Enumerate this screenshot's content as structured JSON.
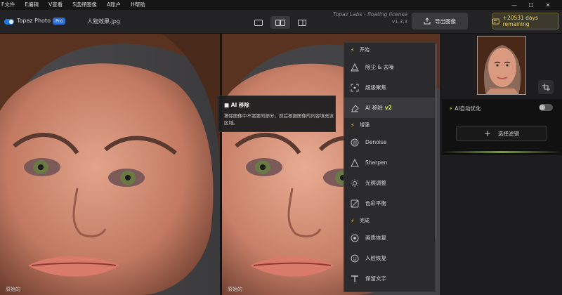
{
  "menubar": {
    "items": [
      "F文件",
      "E编辑",
      "V查看",
      "S选择图像",
      "A账户",
      "H帮助"
    ]
  },
  "window": {
    "minimize": "—",
    "maximize": "☐",
    "close": "✕"
  },
  "toolbar": {
    "app_name": "Topaz Photo",
    "pro_badge": "Pro",
    "file_name": "人物效果.jpg",
    "license_line1": "Topaz Labs - floating license",
    "license_line2": "v1.3.3",
    "export_label": "导出图像",
    "days_remaining": "+20531 days remaining"
  },
  "photos": {
    "left_caption": "原始的",
    "right_caption": "原始的"
  },
  "tooltip": {
    "title": "AI 移除",
    "body": "擦除图像中不需要的部分，然后根据图像的内容填充该区域。"
  },
  "menu": {
    "items": [
      {
        "type": "section",
        "label": "开始"
      },
      {
        "type": "item",
        "icon": "triangle-blur-icon",
        "label": "除尘 & 去噪"
      },
      {
        "type": "item",
        "icon": "focus-icon",
        "label": "超级聚焦"
      },
      {
        "type": "item",
        "icon": "eraser-icon",
        "label": "AI 移除",
        "badge": "v2"
      },
      {
        "type": "section",
        "label": "增强"
      },
      {
        "type": "item",
        "icon": "denoise-icon",
        "label": "Denoise"
      },
      {
        "type": "item",
        "icon": "sharpen-icon",
        "label": "Sharpen"
      },
      {
        "type": "item",
        "icon": "light-icon",
        "label": "光照调整"
      },
      {
        "type": "item",
        "icon": "color-balance-icon",
        "label": "色彩平衡"
      },
      {
        "type": "section",
        "label": "完成"
      },
      {
        "type": "item",
        "icon": "restore-icon",
        "label": "画质恢复"
      },
      {
        "type": "item",
        "icon": "face-icon",
        "label": "人脸恢复"
      },
      {
        "type": "item",
        "icon": "text-icon",
        "label": "保留文字"
      }
    ]
  },
  "sidebar": {
    "ai_auto_label": "AI自动优化",
    "add_filter_label": "选择滤镜"
  },
  "colors": {
    "accent_blue": "#1f7ae0",
    "accent_green": "#c8e84a",
    "bolt_yellow": "#f2c94c",
    "days_text": "#f2d260"
  }
}
